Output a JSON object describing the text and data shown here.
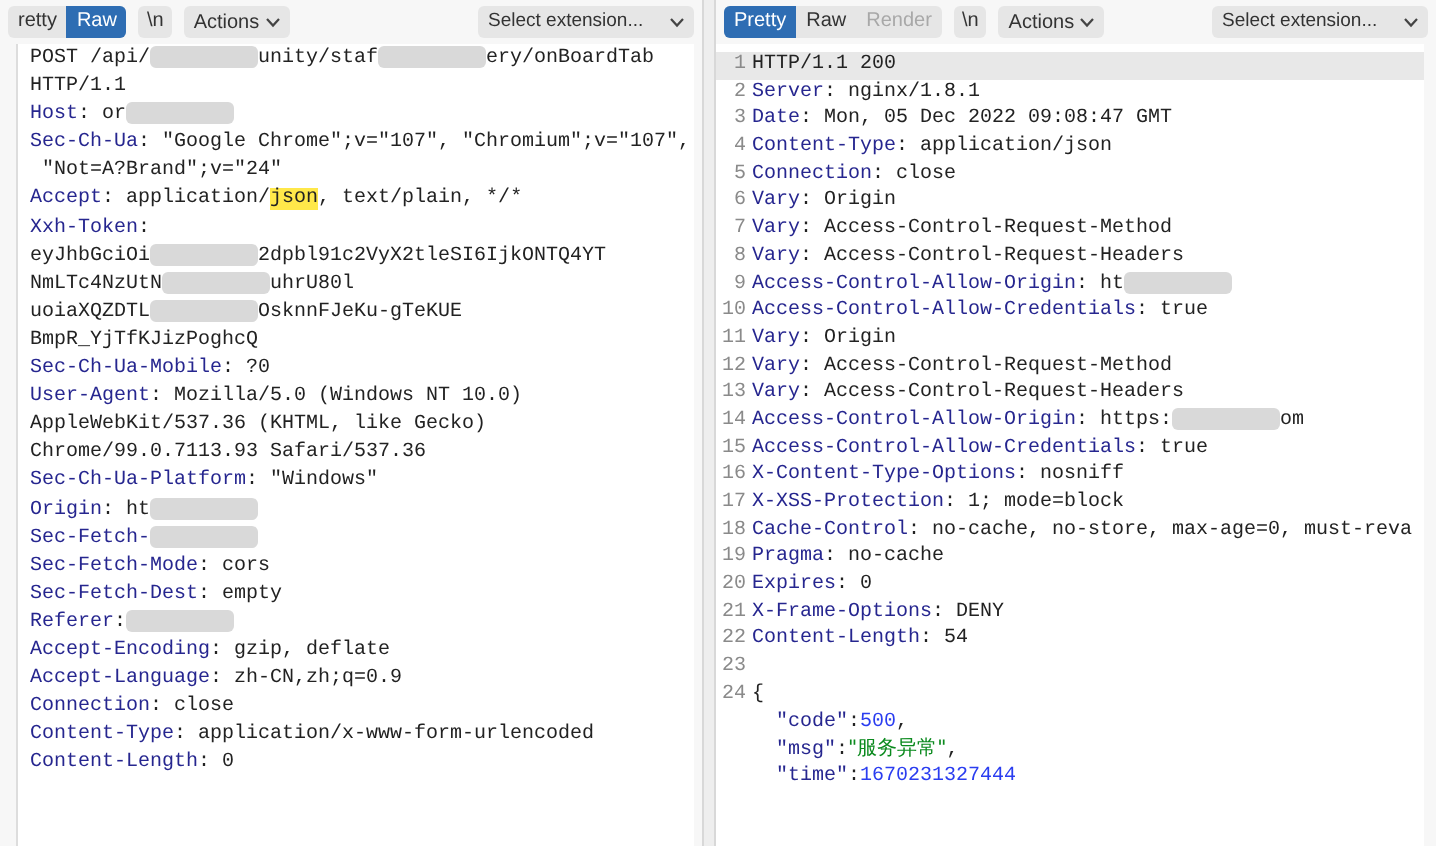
{
  "request": {
    "tabs": [
      {
        "label": "retty",
        "selected": false
      },
      {
        "label": "Raw",
        "selected": true
      }
    ],
    "newline_button": "\\n",
    "actions_button": "Actions",
    "extension_select": "Select extension...",
    "lines": [
      {
        "parts": [
          {
            "kind": "text",
            "text": "POST /api/"
          },
          {
            "kind": "redaction"
          },
          {
            "kind": "text",
            "text": "unity/staf"
          },
          {
            "kind": "redaction"
          },
          {
            "kind": "text",
            "text": "ery/onBoardTab"
          }
        ]
      },
      {
        "parts": [
          {
            "kind": "text",
            "text": "HTTP/1.1"
          }
        ]
      },
      {
        "parts": [
          {
            "kind": "key",
            "text": "Host"
          },
          {
            "kind": "text",
            "text": ": or"
          },
          {
            "kind": "redaction"
          }
        ]
      },
      {
        "parts": [
          {
            "kind": "key",
            "text": "Sec-Ch-Ua"
          },
          {
            "kind": "text",
            "text": ": \"Google Chrome\";v=\"107\", \"Chromium\";v=\"107\","
          }
        ]
      },
      {
        "parts": [
          {
            "kind": "text",
            "text": " \"Not=A?Brand\";v=\"24\""
          }
        ]
      },
      {
        "parts": [
          {
            "kind": "key",
            "text": "Accept"
          },
          {
            "kind": "text",
            "text": ": application/"
          },
          {
            "kind": "highlight",
            "text": "json"
          },
          {
            "kind": "text",
            "text": ", text/plain, */*"
          }
        ]
      },
      {
        "parts": [
          {
            "kind": "key",
            "text": "Xxh-Token"
          },
          {
            "kind": "text",
            "text": ":"
          }
        ]
      },
      {
        "parts": [
          {
            "kind": "text",
            "text": "eyJhbGciOi"
          },
          {
            "kind": "redaction"
          },
          {
            "kind": "text",
            "text": "2dpbl91c2VyX2tleSI6IjkONTQ4YT"
          }
        ]
      },
      {
        "parts": [
          {
            "kind": "text",
            "text": "NmLTc4NzUtN"
          },
          {
            "kind": "redaction"
          },
          {
            "kind": "text",
            "text": "uhrU80l"
          }
        ]
      },
      {
        "parts": [
          {
            "kind": "text",
            "text": "uoiaXQZDTL"
          },
          {
            "kind": "redaction"
          },
          {
            "kind": "text",
            "text": "OsknnFJeKu-gTeKUE"
          }
        ]
      },
      {
        "parts": [
          {
            "kind": "text",
            "text": "BmpR_YjTfKJizPoghcQ"
          }
        ]
      },
      {
        "parts": [
          {
            "kind": "key",
            "text": "Sec-Ch-Ua-Mobile"
          },
          {
            "kind": "text",
            "text": ": ?0"
          }
        ]
      },
      {
        "parts": [
          {
            "kind": "key",
            "text": "User-Agent"
          },
          {
            "kind": "text",
            "text": ": Mozilla/5.0 (Windows NT 10.0)"
          }
        ]
      },
      {
        "parts": [
          {
            "kind": "text",
            "text": "AppleWebKit/537.36 (KHTML, like Gecko)"
          }
        ]
      },
      {
        "parts": [
          {
            "kind": "text",
            "text": "Chrome/99.0.7113.93 Safari/537.36"
          }
        ]
      },
      {
        "parts": [
          {
            "kind": "key",
            "text": "Sec-Ch-Ua-Platform"
          },
          {
            "kind": "text",
            "text": ": \"Windows\""
          }
        ]
      },
      {
        "parts": [
          {
            "kind": "key",
            "text": "Origin"
          },
          {
            "kind": "text",
            "text": ": ht"
          },
          {
            "kind": "redaction"
          }
        ]
      },
      {
        "parts": [
          {
            "kind": "key",
            "text": "Sec-Fetch-"
          },
          {
            "kind": "redaction"
          }
        ]
      },
      {
        "parts": [
          {
            "kind": "key",
            "text": "Sec-Fetch-Mode"
          },
          {
            "kind": "text",
            "text": ": cors"
          }
        ]
      },
      {
        "parts": [
          {
            "kind": "key",
            "text": "Sec-Fetch-Dest"
          },
          {
            "kind": "text",
            "text": ": empty"
          }
        ]
      },
      {
        "parts": [
          {
            "kind": "key",
            "text": "Referer"
          },
          {
            "kind": "text",
            "text": ":"
          },
          {
            "kind": "redaction"
          }
        ]
      },
      {
        "parts": [
          {
            "kind": "key",
            "text": "Accept-Encoding"
          },
          {
            "kind": "text",
            "text": ": gzip, deflate"
          }
        ]
      },
      {
        "parts": [
          {
            "kind": "key",
            "text": "Accept-Language"
          },
          {
            "kind": "text",
            "text": ": zh-CN,zh;q=0.9"
          }
        ]
      },
      {
        "parts": [
          {
            "kind": "key",
            "text": "Connection"
          },
          {
            "kind": "text",
            "text": ": close"
          }
        ]
      },
      {
        "parts": [
          {
            "kind": "key",
            "text": "Content-Type"
          },
          {
            "kind": "text",
            "text": ": application/x-www-form-urlencoded"
          }
        ]
      },
      {
        "parts": [
          {
            "kind": "key",
            "text": "Content-Length"
          },
          {
            "kind": "text",
            "text": ": 0"
          }
        ]
      }
    ]
  },
  "response": {
    "tabs": [
      {
        "label": "Pretty",
        "selected": true,
        "disabled": false
      },
      {
        "label": "Raw",
        "selected": false,
        "disabled": false
      },
      {
        "label": "Render",
        "selected": false,
        "disabled": true
      }
    ],
    "newline_button": "\\n",
    "actions_button": "Actions",
    "extension_select": "Select extension...",
    "lines": [
      {
        "number": "1",
        "current": true,
        "parts": [
          {
            "kind": "text",
            "text": "HTTP/1.1 200"
          }
        ]
      },
      {
        "number": "2",
        "current": false,
        "parts": [
          {
            "kind": "key",
            "text": "Server"
          },
          {
            "kind": "text",
            "text": ": nginx/1.8.1"
          }
        ]
      },
      {
        "number": "3",
        "current": false,
        "parts": [
          {
            "kind": "key",
            "text": "Date"
          },
          {
            "kind": "text",
            "text": ": Mon, 05 Dec 2022 09:08:47 GMT"
          }
        ]
      },
      {
        "number": "4",
        "current": false,
        "parts": [
          {
            "kind": "key",
            "text": "Content-Type"
          },
          {
            "kind": "text",
            "text": ": application/json"
          }
        ]
      },
      {
        "number": "5",
        "current": false,
        "parts": [
          {
            "kind": "key",
            "text": "Connection"
          },
          {
            "kind": "text",
            "text": ": close"
          }
        ]
      },
      {
        "number": "6",
        "current": false,
        "parts": [
          {
            "kind": "key",
            "text": "Vary"
          },
          {
            "kind": "text",
            "text": ": Origin"
          }
        ]
      },
      {
        "number": "7",
        "current": false,
        "parts": [
          {
            "kind": "key",
            "text": "Vary"
          },
          {
            "kind": "text",
            "text": ": Access-Control-Request-Method"
          }
        ]
      },
      {
        "number": "8",
        "current": false,
        "parts": [
          {
            "kind": "key",
            "text": "Vary"
          },
          {
            "kind": "text",
            "text": ": Access-Control-Request-Headers"
          }
        ]
      },
      {
        "number": "9",
        "current": false,
        "parts": [
          {
            "kind": "key",
            "text": "Access-Control-Allow-Origin"
          },
          {
            "kind": "text",
            "text": ": ht"
          },
          {
            "kind": "redaction"
          }
        ]
      },
      {
        "number": "10",
        "current": false,
        "parts": [
          {
            "kind": "key",
            "text": "Access-Control-Allow-Credentials"
          },
          {
            "kind": "text",
            "text": ": true"
          }
        ]
      },
      {
        "number": "11",
        "current": false,
        "parts": [
          {
            "kind": "key",
            "text": "Vary"
          },
          {
            "kind": "text",
            "text": ": Origin"
          }
        ]
      },
      {
        "number": "12",
        "current": false,
        "parts": [
          {
            "kind": "key",
            "text": "Vary"
          },
          {
            "kind": "text",
            "text": ": Access-Control-Request-Method"
          }
        ]
      },
      {
        "number": "13",
        "current": false,
        "parts": [
          {
            "kind": "key",
            "text": "Vary"
          },
          {
            "kind": "text",
            "text": ": Access-Control-Request-Headers"
          }
        ]
      },
      {
        "number": "14",
        "current": false,
        "parts": [
          {
            "kind": "key",
            "text": "Access-Control-Allow-Origin"
          },
          {
            "kind": "text",
            "text": ": https:"
          },
          {
            "kind": "redaction"
          },
          {
            "kind": "text",
            "text": "om"
          }
        ]
      },
      {
        "number": "15",
        "current": false,
        "parts": [
          {
            "kind": "key",
            "text": "Access-Control-Allow-Credentials"
          },
          {
            "kind": "text",
            "text": ": true"
          }
        ]
      },
      {
        "number": "16",
        "current": false,
        "parts": [
          {
            "kind": "key",
            "text": "X-Content-Type-Options"
          },
          {
            "kind": "text",
            "text": ": nosniff"
          }
        ]
      },
      {
        "number": "17",
        "current": false,
        "parts": [
          {
            "kind": "key",
            "text": "X-XSS-Protection"
          },
          {
            "kind": "text",
            "text": ": 1; mode=block"
          }
        ]
      },
      {
        "number": "18",
        "current": false,
        "parts": [
          {
            "kind": "key",
            "text": "Cache-Control"
          },
          {
            "kind": "text",
            "text": ": no-cache, no-store, max-age=0, must-reva"
          }
        ]
      },
      {
        "number": "19",
        "current": false,
        "parts": [
          {
            "kind": "key",
            "text": "Pragma"
          },
          {
            "kind": "text",
            "text": ": no-cache"
          }
        ]
      },
      {
        "number": "20",
        "current": false,
        "parts": [
          {
            "kind": "key",
            "text": "Expires"
          },
          {
            "kind": "text",
            "text": ": 0"
          }
        ]
      },
      {
        "number": "21",
        "current": false,
        "parts": [
          {
            "kind": "key",
            "text": "X-Frame-Options"
          },
          {
            "kind": "text",
            "text": ": DENY"
          }
        ]
      },
      {
        "number": "22",
        "current": false,
        "parts": [
          {
            "kind": "key",
            "text": "Content-Length"
          },
          {
            "kind": "text",
            "text": ": 54"
          }
        ]
      },
      {
        "number": "23",
        "current": false
      },
      {
        "number": "24",
        "current": false,
        "parts": [
          {
            "kind": "text",
            "text": "{"
          }
        ]
      },
      {
        "current": false,
        "parts": [
          {
            "kind": "jkey",
            "text": "  \"code\""
          },
          {
            "kind": "text",
            "text": ":"
          },
          {
            "kind": "number",
            "text": "500"
          },
          {
            "kind": "text",
            "text": ","
          }
        ]
      },
      {
        "current": false,
        "parts": [
          {
            "kind": "jkey",
            "text": "  \"msg\""
          },
          {
            "kind": "text",
            "text": ":"
          },
          {
            "kind": "string",
            "text": "\"服务异常\""
          },
          {
            "kind": "text",
            "text": ","
          }
        ]
      },
      {
        "current": false,
        "parts": [
          {
            "kind": "jkey",
            "text": "  \"time\""
          },
          {
            "kind": "text",
            "text": ":"
          },
          {
            "kind": "number",
            "text": "1670231327444"
          }
        ]
      }
    ]
  }
}
